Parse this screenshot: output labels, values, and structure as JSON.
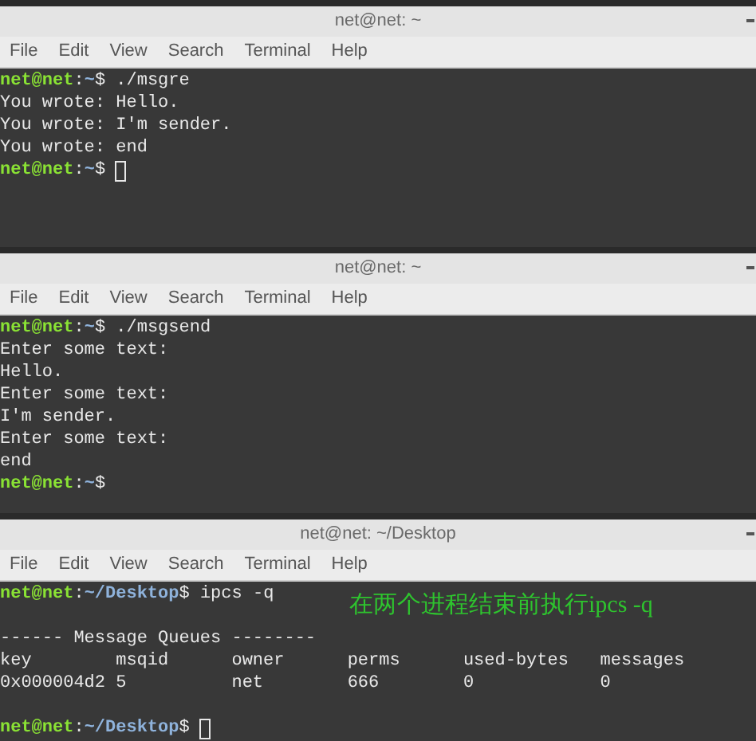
{
  "windows": [
    {
      "title": "net@net: ~",
      "menu": [
        "File",
        "Edit",
        "View",
        "Search",
        "Terminal",
        "Help"
      ],
      "lines": [
        {
          "kind": "prompt",
          "user": "net@net",
          "sep": ":",
          "path": "~",
          "sign": "$",
          "command": "./msgre"
        },
        {
          "kind": "output",
          "text": "You wrote: Hello."
        },
        {
          "kind": "output",
          "text": "You wrote: I'm sender."
        },
        {
          "kind": "output",
          "text": "You wrote: end"
        },
        {
          "kind": "prompt",
          "user": "net@net",
          "sep": ":",
          "path": "~",
          "sign": "$",
          "cursor": true
        }
      ]
    },
    {
      "title": "net@net: ~",
      "menu": [
        "File",
        "Edit",
        "View",
        "Search",
        "Terminal",
        "Help"
      ],
      "lines": [
        {
          "kind": "prompt",
          "user": "net@net",
          "sep": ":",
          "path": "~",
          "sign": "$",
          "command": "./msgsend"
        },
        {
          "kind": "output",
          "text": "Enter some text:"
        },
        {
          "kind": "output",
          "text": "Hello."
        },
        {
          "kind": "output",
          "text": "Enter some text:"
        },
        {
          "kind": "output",
          "text": "I'm sender."
        },
        {
          "kind": "output",
          "text": "Enter some text:"
        },
        {
          "kind": "output",
          "text": "end"
        },
        {
          "kind": "prompt",
          "user": "net@net",
          "sep": ":",
          "path": "~",
          "sign": "$",
          "cursor": false
        }
      ]
    },
    {
      "title": "net@net: ~/Desktop",
      "menu": [
        "File",
        "Edit",
        "View",
        "Search",
        "Terminal",
        "Help"
      ],
      "annotation": "在两个进程结束前执行ipcs -q",
      "lines": [
        {
          "kind": "prompt",
          "user": "net@net",
          "sep": ":",
          "path": "~/Desktop",
          "sign": "$",
          "command": "ipcs -q"
        },
        {
          "kind": "blank"
        },
        {
          "kind": "output",
          "text": "------ Message Queues --------"
        },
        {
          "kind": "table",
          "columns": [
            "key",
            "msqid",
            "owner",
            "perms",
            "used-bytes",
            "messages"
          ],
          "rows": [
            [
              "0x000004d2",
              "5",
              "net",
              "666",
              "0",
              "0"
            ]
          ]
        },
        {
          "kind": "blank"
        },
        {
          "kind": "prompt",
          "user": "net@net",
          "sep": ":",
          "path": "~/Desktop",
          "sign": "$",
          "cursor": true
        }
      ]
    }
  ]
}
